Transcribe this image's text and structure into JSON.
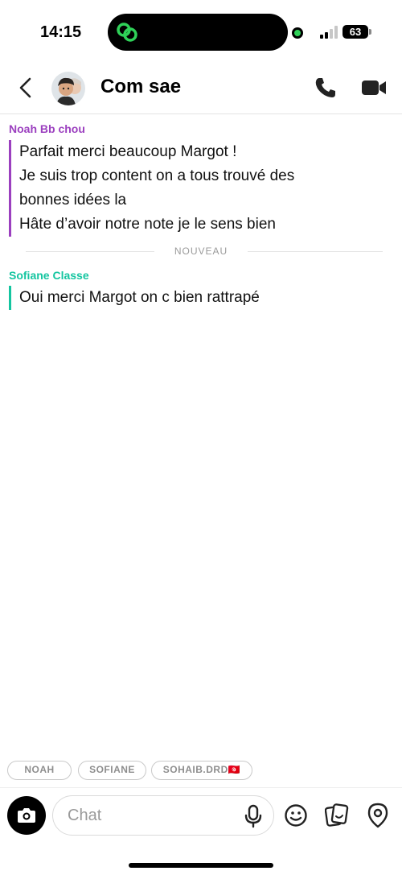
{
  "status_bar": {
    "time": "14:15",
    "battery": "63",
    "island_icon": "link-icon",
    "island_icon_color": "#2fd158"
  },
  "header": {
    "title": "Com sae",
    "back_icon": "chevron-left-icon",
    "call_icon": "phone-icon",
    "video_icon": "video-camera-icon"
  },
  "messages": [
    {
      "sender": "Noah Bb chou",
      "color": "#9b3fbf",
      "lines": [
        "Parfait merci beaucoup Margot !",
        "Je suis trop content on a tous trouvé des",
        "bonnes idées la",
        "Hâte d’avoir notre note je le sens bien"
      ]
    },
    {
      "sender": "Sofiane Classe",
      "color": "#14c5a0",
      "lines": [
        "Oui merci Margot on c bien rattrapé"
      ]
    }
  ],
  "divider": {
    "label": "NOUVEAU"
  },
  "participants": [
    "NOAH",
    "SOFIANE",
    "SOHAIB.DRD"
  ],
  "participant_flag": "🇹🇳",
  "input": {
    "placeholder": "Chat",
    "value": ""
  },
  "toolbar_icons": [
    "camera-icon",
    "microphone-icon",
    "emoji-icon",
    "sticker-icon",
    "map-pin-icon"
  ]
}
